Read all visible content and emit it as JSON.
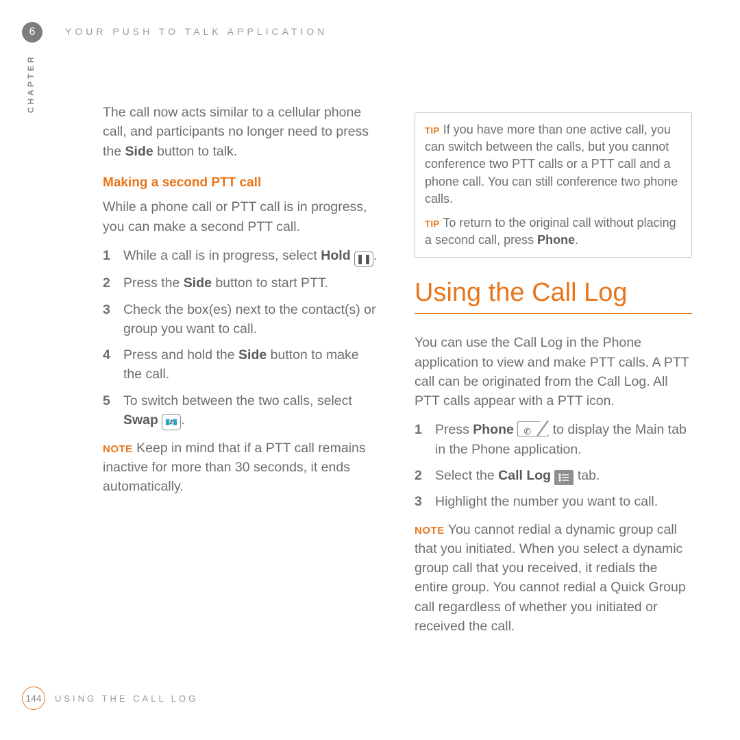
{
  "chapter": {
    "number": "6",
    "label": "CHAPTER"
  },
  "running_head": "YOUR PUSH TO TALK APPLICATION",
  "col1": {
    "intro": "The call now acts similar to a cellular phone call, and participants no longer need to press the ",
    "intro_b": "Side",
    "intro2": " button to talk.",
    "subhead": "Making a second PTT call",
    "lead": "While a phone call or PTT call is in progress, you can make a second PTT call.",
    "s1a": "While a call is in progress, select ",
    "s1b": "Hold",
    "s2a": "Press the ",
    "s2b": "Side",
    "s2c": " button to start PTT.",
    "s3": "Check the box(es) next to the contact(s) or group you want to call.",
    "s4a": "Press and hold the ",
    "s4b": "Side",
    "s4c": " button to make the call.",
    "s5a": "To switch between the two calls, select ",
    "s5b": "Swap",
    "note_lbl": "NOTE",
    "note": " Keep in mind that if a PTT call remains inactive for more than 30 seconds, it ends automatically."
  },
  "col2": {
    "tip_lbl": "TIP",
    "tip1": " If you have more than one active call, you can switch between the calls, but you cannot conference two PTT calls or a PTT call and a phone call. You can still conference two phone calls.",
    "tip2a": " To return to the original call without placing a second call, press ",
    "tip2b": "Phone",
    "h1": "Using the Call Log",
    "lead": "You can use the Call Log in the Phone application to view and make PTT calls. A PTT call can be originated from the Call Log. All PTT calls appear with a PTT icon.",
    "s1a": "Press ",
    "s1b": "Phone",
    "s1c": " to display the Main tab in the Phone application.",
    "s2a": "Select the ",
    "s2b": "Call Log",
    "s2c": " tab.",
    "s3": "Highlight the number you want to call.",
    "note_lbl": "NOTE",
    "note": " You cannot redial a dynamic group call that you initiated. When you select a dynamic group call that you received, it redials the entire group. You cannot redial a Quick Group call regardless of whether you initiated or received the call."
  },
  "footer": {
    "page": "144",
    "title": "USING THE CALL LOG"
  }
}
